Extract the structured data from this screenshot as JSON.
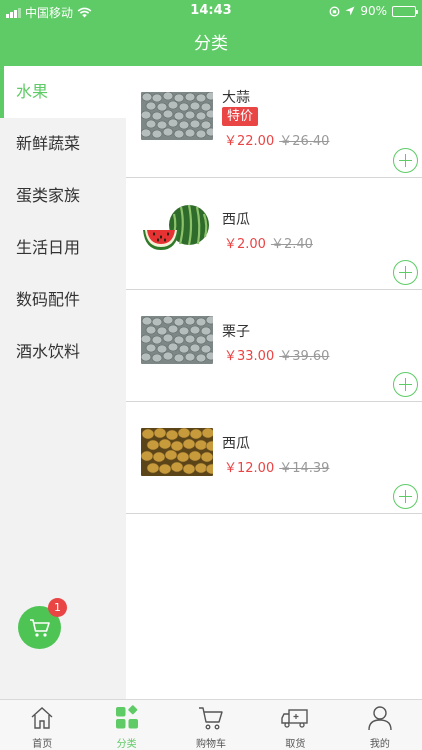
{
  "status_bar": {
    "carrier": "中国移动",
    "time": "14:43",
    "battery": "90%",
    "battery_level": 0.9
  },
  "header": {
    "title": "分类"
  },
  "sidebar": {
    "items": [
      {
        "label": "水果",
        "active": true
      },
      {
        "label": "新鲜蔬菜",
        "active": false
      },
      {
        "label": "蛋类家族",
        "active": false
      },
      {
        "label": "生活日用",
        "active": false
      },
      {
        "label": "数码配件",
        "active": false
      },
      {
        "label": "酒水饮料",
        "active": false
      }
    ]
  },
  "products": [
    {
      "name": "大蒜",
      "tag": "特价",
      "price": "￥22.00",
      "old_price": "￥26.40",
      "image": "nuts-image"
    },
    {
      "name": "西瓜",
      "tag": "",
      "price": "￥2.00",
      "old_price": "￥2.40",
      "image": "watermelon-image"
    },
    {
      "name": "栗子",
      "tag": "",
      "price": "￥33.00",
      "old_price": "￥39.60",
      "image": "nuts-image"
    },
    {
      "name": "西瓜",
      "tag": "",
      "price": "￥12.00",
      "old_price": "￥14.39",
      "image": "potato-image"
    }
  ],
  "cart": {
    "badge_count": "1"
  },
  "tabbar": {
    "items": [
      {
        "label": "首页",
        "icon": "home-icon",
        "active": false
      },
      {
        "label": "分类",
        "icon": "category-icon",
        "active": true
      },
      {
        "label": "购物车",
        "icon": "cart-icon",
        "active": false
      },
      {
        "label": "取货",
        "icon": "truck-icon",
        "active": false
      },
      {
        "label": "我的",
        "icon": "user-icon",
        "active": false
      }
    ]
  },
  "colors": {
    "brand_green": "#5fcb66",
    "price_red": "#e94545",
    "sidebar_bg": "#f2f2f2"
  }
}
